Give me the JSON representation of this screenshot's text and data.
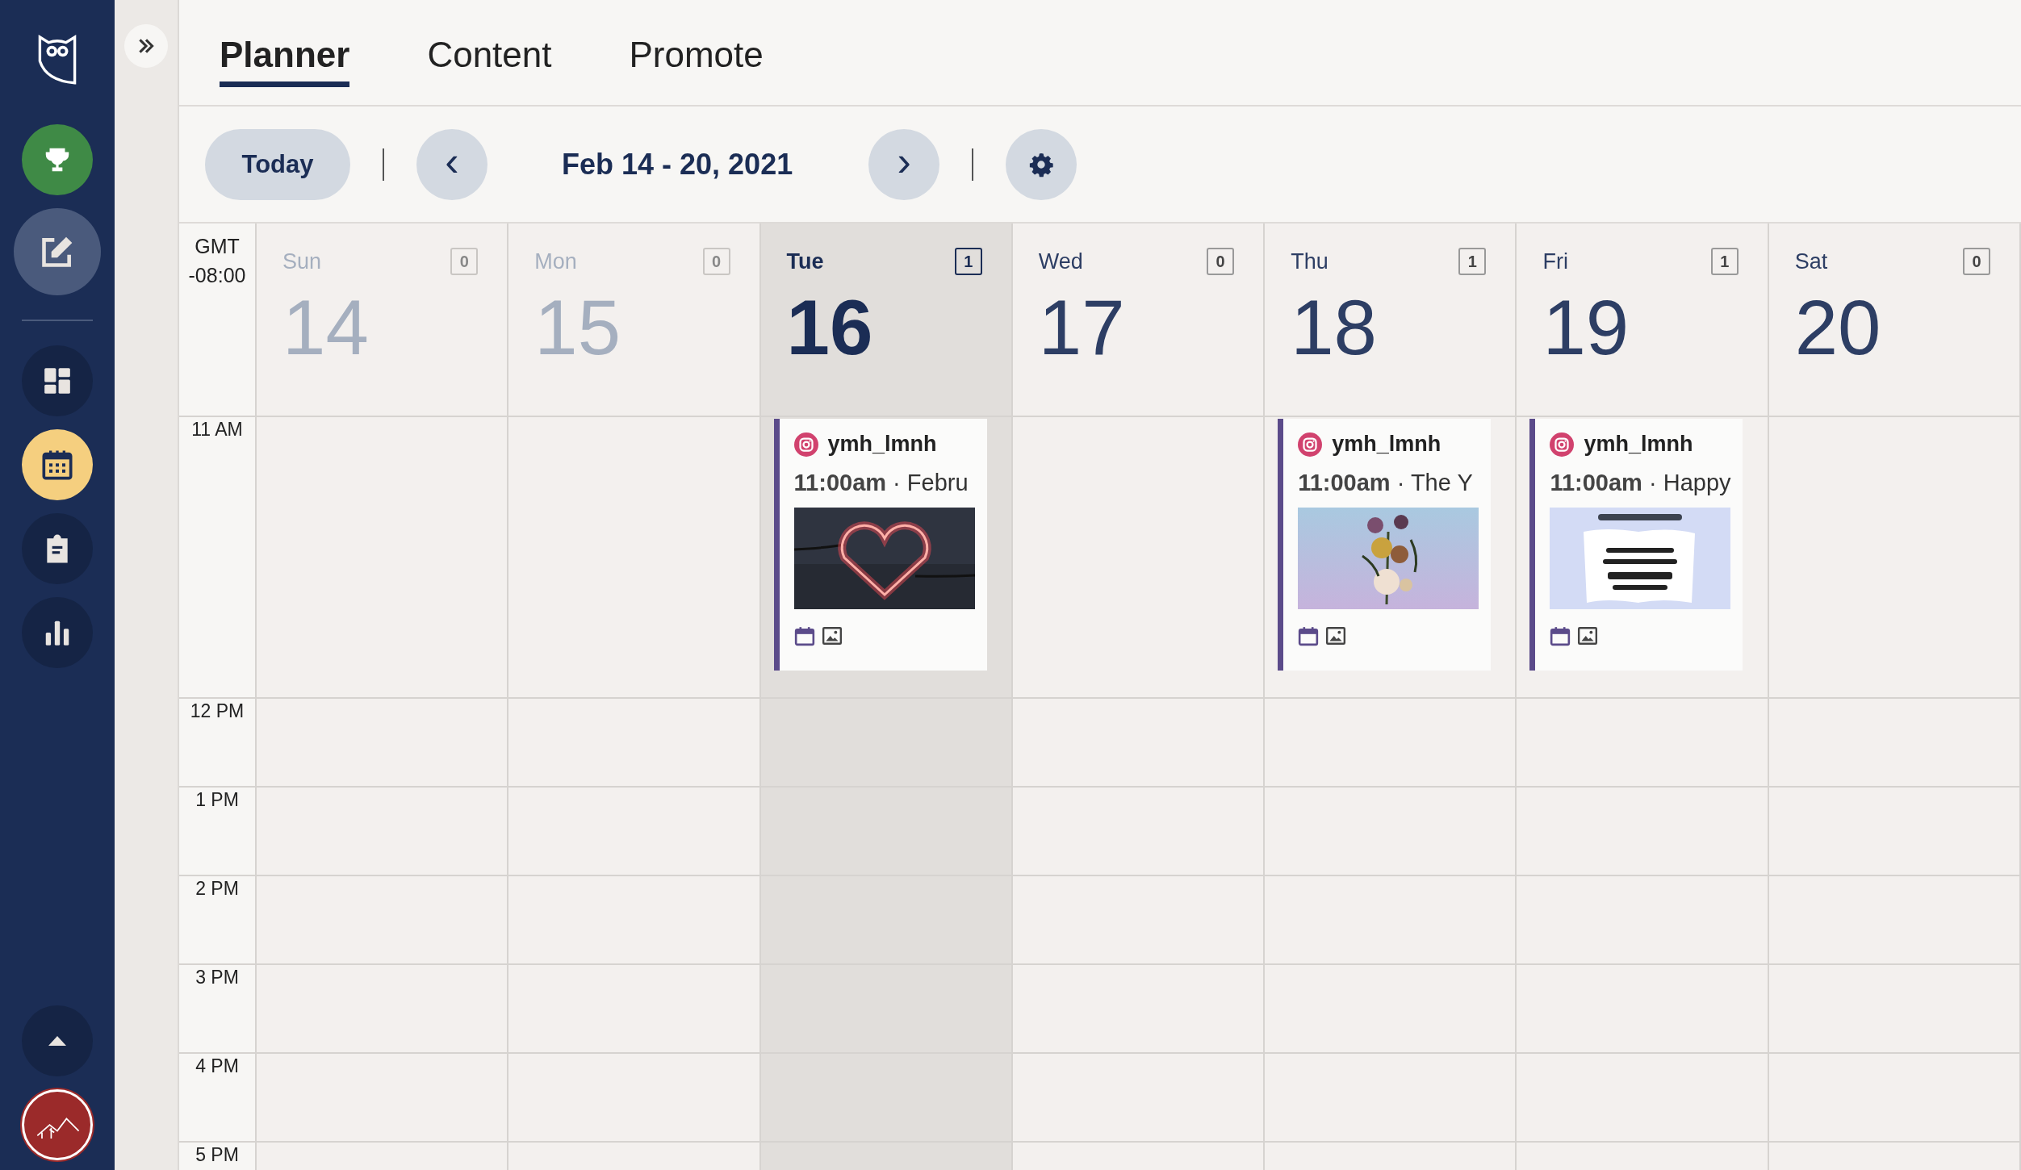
{
  "sidebar": {
    "items": [
      {
        "selected": false
      },
      {
        "selected": false
      },
      {
        "selected": false
      },
      {
        "selected": true
      },
      {
        "selected": false
      },
      {
        "selected": false
      }
    ]
  },
  "tabs": [
    {
      "label": "Planner",
      "selected": true
    },
    {
      "label": "Content",
      "selected": false
    },
    {
      "label": "Promote",
      "selected": false
    }
  ],
  "toolbar": {
    "today": "Today",
    "prev": "‹",
    "range": "Feb 14 - 20, 2021",
    "next": "›"
  },
  "calendar": {
    "timezone": [
      "GMT",
      "-08:00"
    ],
    "days": [
      {
        "name": "Sun",
        "date": "14",
        "count": "0",
        "past": true,
        "selected": false
      },
      {
        "name": "Mon",
        "date": "15",
        "count": "0",
        "past": true,
        "selected": false
      },
      {
        "name": "Tue",
        "date": "16",
        "count": "1",
        "past": false,
        "selected": true,
        "events": [
          {
            "account": "ymh_lmnh",
            "time": "11:00am",
            "title": "· Febru"
          }
        ]
      },
      {
        "name": "Wed",
        "date": "17",
        "count": "0",
        "past": false,
        "selected": false
      },
      {
        "name": "Thu",
        "date": "18",
        "count": "1",
        "past": false,
        "selected": false,
        "events": [
          {
            "account": "ymh_lmnh",
            "time": "11:00am",
            "title": "· The Y"
          }
        ]
      },
      {
        "name": "Fri",
        "date": "19",
        "count": "1",
        "past": false,
        "selected": false,
        "events": [
          {
            "account": "ymh_lmnh",
            "time": "11:00am",
            "title": "· Happy"
          }
        ]
      },
      {
        "name": "Sat",
        "date": "20",
        "count": "0",
        "past": false,
        "selected": false
      }
    ],
    "hours": [
      "11 AM",
      "12 PM",
      "1 PM",
      "2 PM",
      "3 PM",
      "4 PM",
      "5 PM"
    ]
  }
}
